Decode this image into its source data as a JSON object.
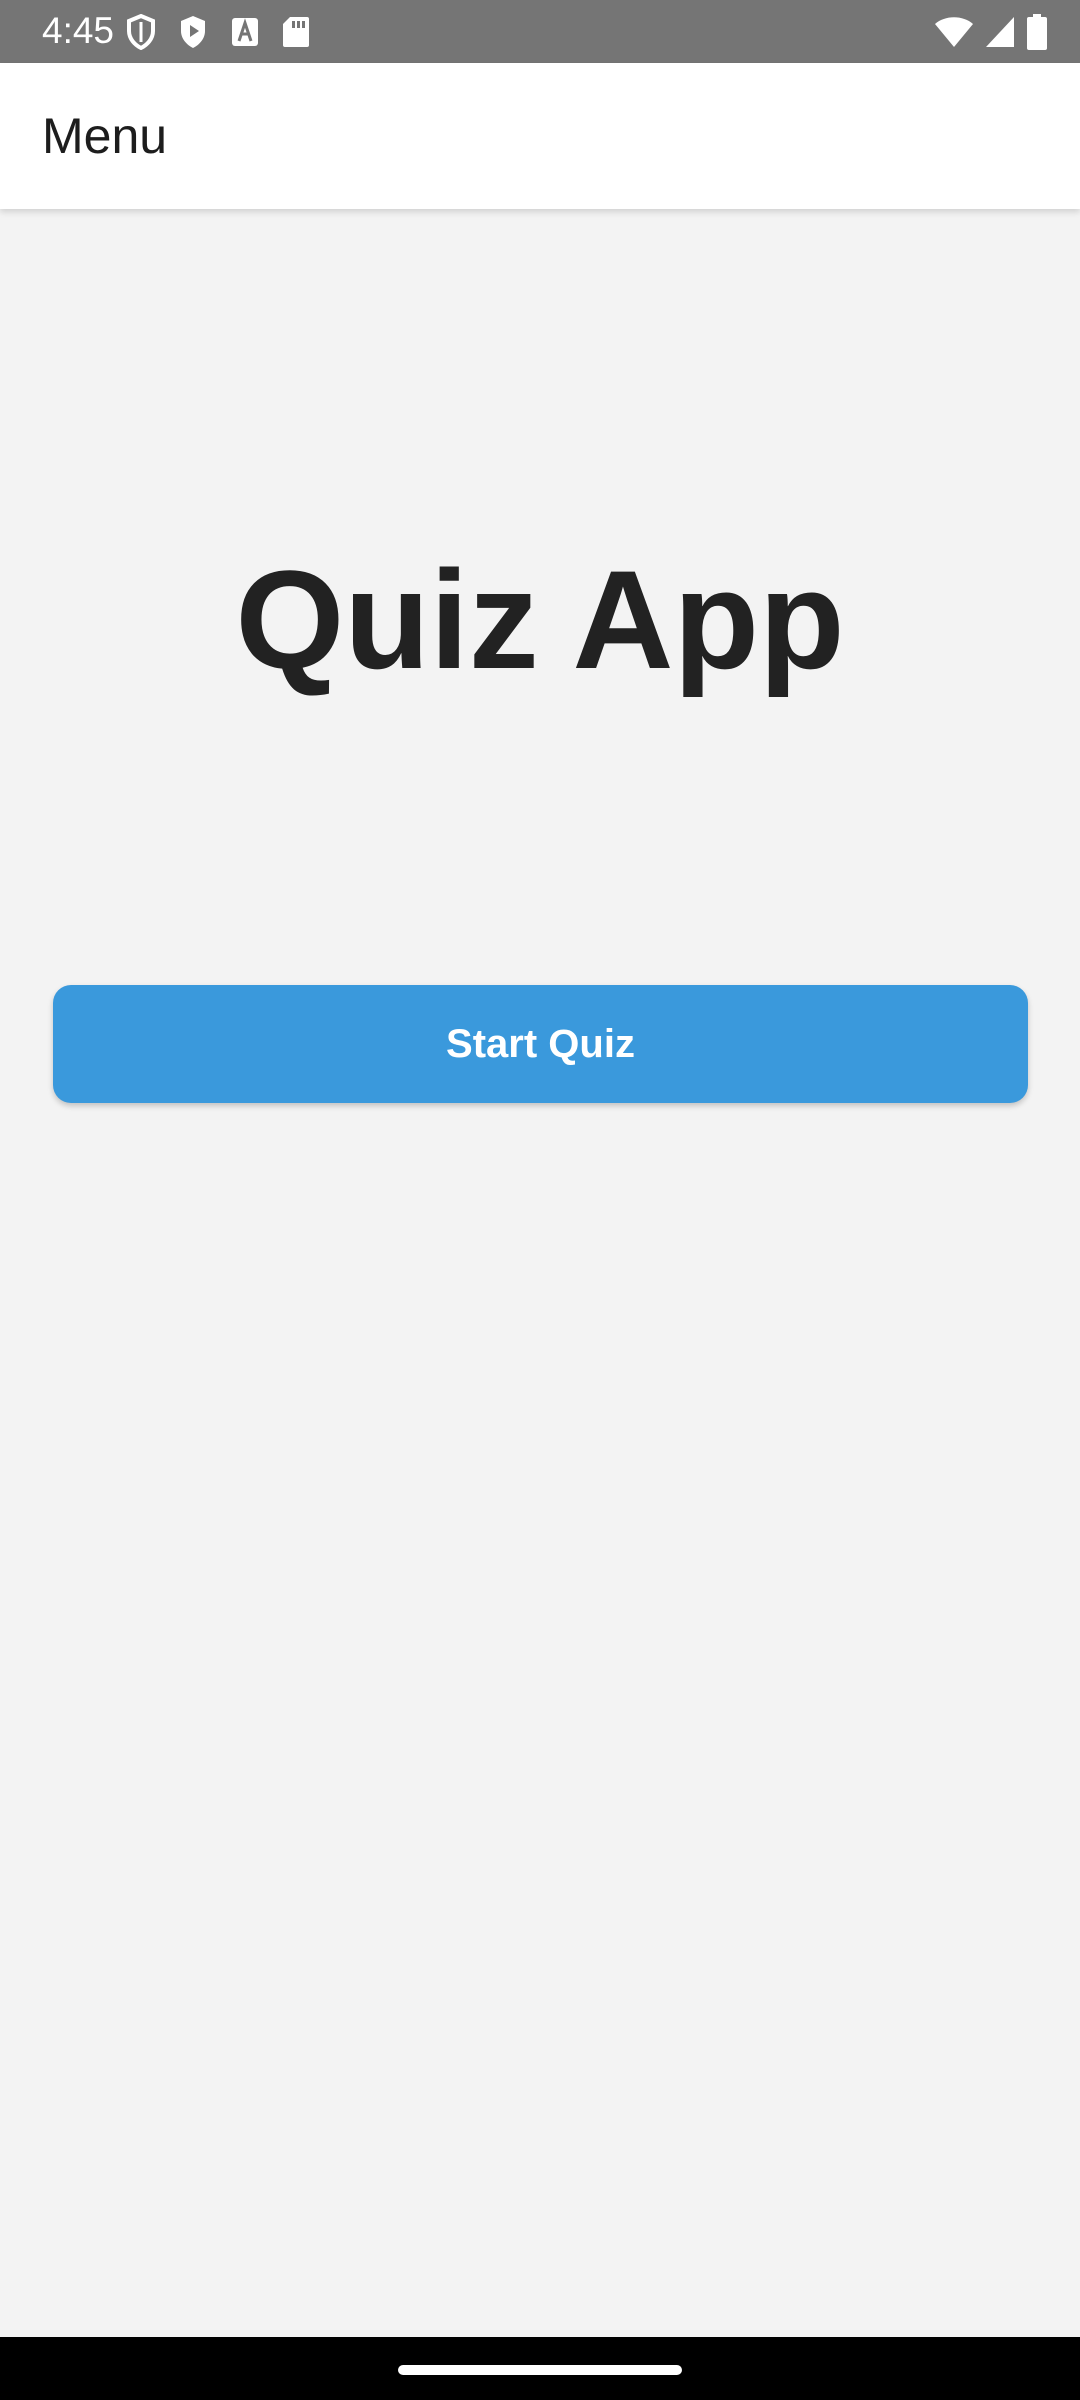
{
  "status_bar": {
    "time": "4:45",
    "left_icons": [
      "shield-icon",
      "play-protect-icon",
      "font-icon",
      "sd-card-icon"
    ],
    "right_icons": [
      "wifi-icon",
      "cell-signal-icon",
      "battery-icon"
    ]
  },
  "app_bar": {
    "title": "Menu"
  },
  "main": {
    "title": "Quiz App",
    "start_button_label": "Start Quiz"
  },
  "colors": {
    "status_bar_bg": "#757575",
    "app_bar_bg": "#ffffff",
    "page_bg": "#f3f3f3",
    "accent": "#3a99dc",
    "title_text": "#222222"
  }
}
